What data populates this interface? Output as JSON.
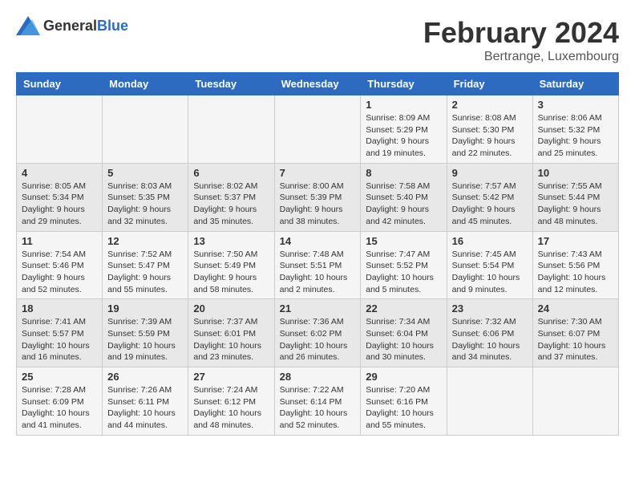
{
  "logo": {
    "text_general": "General",
    "text_blue": "Blue"
  },
  "title": "February 2024",
  "subtitle": "Bertrange, Luxembourg",
  "days_of_week": [
    "Sunday",
    "Monday",
    "Tuesday",
    "Wednesday",
    "Thursday",
    "Friday",
    "Saturday"
  ],
  "weeks": [
    [
      {
        "day": "",
        "info": ""
      },
      {
        "day": "",
        "info": ""
      },
      {
        "day": "",
        "info": ""
      },
      {
        "day": "",
        "info": ""
      },
      {
        "day": "1",
        "info": "Sunrise: 8:09 AM\nSunset: 5:29 PM\nDaylight: 9 hours and 19 minutes."
      },
      {
        "day": "2",
        "info": "Sunrise: 8:08 AM\nSunset: 5:30 PM\nDaylight: 9 hours and 22 minutes."
      },
      {
        "day": "3",
        "info": "Sunrise: 8:06 AM\nSunset: 5:32 PM\nDaylight: 9 hours and 25 minutes."
      }
    ],
    [
      {
        "day": "4",
        "info": "Sunrise: 8:05 AM\nSunset: 5:34 PM\nDaylight: 9 hours and 29 minutes."
      },
      {
        "day": "5",
        "info": "Sunrise: 8:03 AM\nSunset: 5:35 PM\nDaylight: 9 hours and 32 minutes."
      },
      {
        "day": "6",
        "info": "Sunrise: 8:02 AM\nSunset: 5:37 PM\nDaylight: 9 hours and 35 minutes."
      },
      {
        "day": "7",
        "info": "Sunrise: 8:00 AM\nSunset: 5:39 PM\nDaylight: 9 hours and 38 minutes."
      },
      {
        "day": "8",
        "info": "Sunrise: 7:58 AM\nSunset: 5:40 PM\nDaylight: 9 hours and 42 minutes."
      },
      {
        "day": "9",
        "info": "Sunrise: 7:57 AM\nSunset: 5:42 PM\nDaylight: 9 hours and 45 minutes."
      },
      {
        "day": "10",
        "info": "Sunrise: 7:55 AM\nSunset: 5:44 PM\nDaylight: 9 hours and 48 minutes."
      }
    ],
    [
      {
        "day": "11",
        "info": "Sunrise: 7:54 AM\nSunset: 5:46 PM\nDaylight: 9 hours and 52 minutes."
      },
      {
        "day": "12",
        "info": "Sunrise: 7:52 AM\nSunset: 5:47 PM\nDaylight: 9 hours and 55 minutes."
      },
      {
        "day": "13",
        "info": "Sunrise: 7:50 AM\nSunset: 5:49 PM\nDaylight: 9 hours and 58 minutes."
      },
      {
        "day": "14",
        "info": "Sunrise: 7:48 AM\nSunset: 5:51 PM\nDaylight: 10 hours and 2 minutes."
      },
      {
        "day": "15",
        "info": "Sunrise: 7:47 AM\nSunset: 5:52 PM\nDaylight: 10 hours and 5 minutes."
      },
      {
        "day": "16",
        "info": "Sunrise: 7:45 AM\nSunset: 5:54 PM\nDaylight: 10 hours and 9 minutes."
      },
      {
        "day": "17",
        "info": "Sunrise: 7:43 AM\nSunset: 5:56 PM\nDaylight: 10 hours and 12 minutes."
      }
    ],
    [
      {
        "day": "18",
        "info": "Sunrise: 7:41 AM\nSunset: 5:57 PM\nDaylight: 10 hours and 16 minutes."
      },
      {
        "day": "19",
        "info": "Sunrise: 7:39 AM\nSunset: 5:59 PM\nDaylight: 10 hours and 19 minutes."
      },
      {
        "day": "20",
        "info": "Sunrise: 7:37 AM\nSunset: 6:01 PM\nDaylight: 10 hours and 23 minutes."
      },
      {
        "day": "21",
        "info": "Sunrise: 7:36 AM\nSunset: 6:02 PM\nDaylight: 10 hours and 26 minutes."
      },
      {
        "day": "22",
        "info": "Sunrise: 7:34 AM\nSunset: 6:04 PM\nDaylight: 10 hours and 30 minutes."
      },
      {
        "day": "23",
        "info": "Sunrise: 7:32 AM\nSunset: 6:06 PM\nDaylight: 10 hours and 34 minutes."
      },
      {
        "day": "24",
        "info": "Sunrise: 7:30 AM\nSunset: 6:07 PM\nDaylight: 10 hours and 37 minutes."
      }
    ],
    [
      {
        "day": "25",
        "info": "Sunrise: 7:28 AM\nSunset: 6:09 PM\nDaylight: 10 hours and 41 minutes."
      },
      {
        "day": "26",
        "info": "Sunrise: 7:26 AM\nSunset: 6:11 PM\nDaylight: 10 hours and 44 minutes."
      },
      {
        "day": "27",
        "info": "Sunrise: 7:24 AM\nSunset: 6:12 PM\nDaylight: 10 hours and 48 minutes."
      },
      {
        "day": "28",
        "info": "Sunrise: 7:22 AM\nSunset: 6:14 PM\nDaylight: 10 hours and 52 minutes."
      },
      {
        "day": "29",
        "info": "Sunrise: 7:20 AM\nSunset: 6:16 PM\nDaylight: 10 hours and 55 minutes."
      },
      {
        "day": "",
        "info": ""
      },
      {
        "day": "",
        "info": ""
      }
    ]
  ]
}
